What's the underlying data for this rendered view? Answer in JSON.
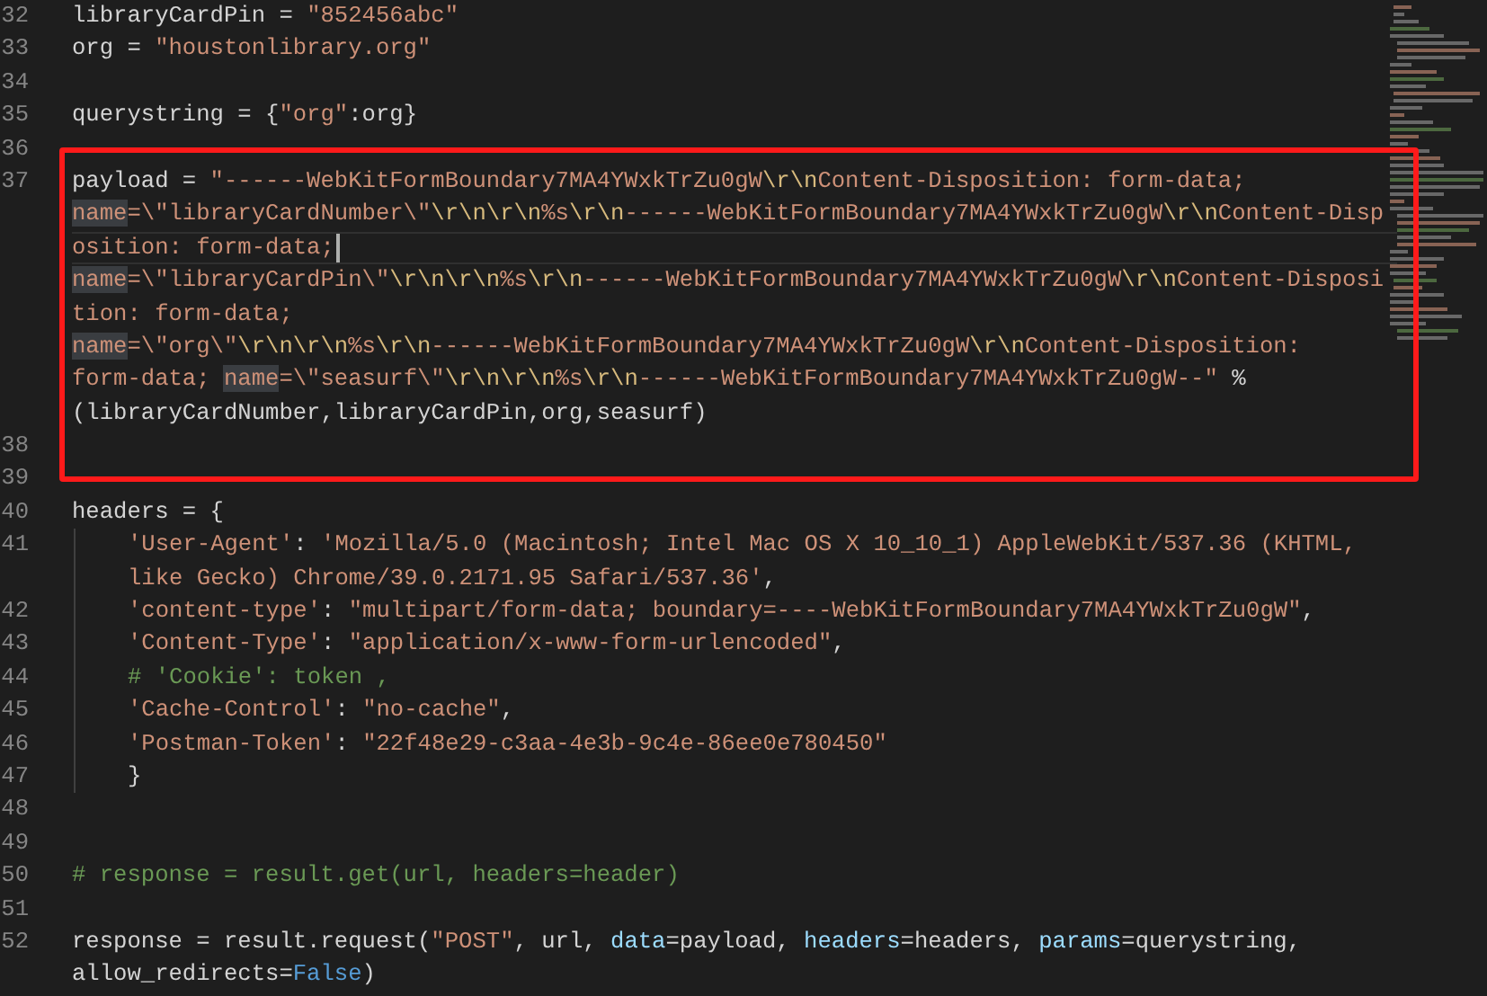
{
  "editor": {
    "lines": [
      {
        "number": "32",
        "indent_guide": false,
        "rows": [
          {
            "current": false,
            "tokens": [
              {
                "kind": "plain",
                "text": "libraryCardPin = "
              },
              {
                "kind": "string",
                "text": "\"852456abc\""
              }
            ]
          }
        ]
      },
      {
        "number": "33",
        "indent_guide": false,
        "rows": [
          {
            "current": false,
            "tokens": [
              {
                "kind": "plain",
                "text": "org = "
              },
              {
                "kind": "string",
                "text": "\"houstonlibrary.org\""
              }
            ]
          }
        ]
      },
      {
        "number": "34",
        "indent_guide": false
      },
      {
        "number": "35",
        "indent_guide": false,
        "rows": [
          {
            "current": false,
            "tokens": [
              {
                "kind": "plain",
                "text": "querystring = {"
              },
              {
                "kind": "string",
                "text": "\"org\""
              },
              {
                "kind": "plain",
                "text": ":org}"
              }
            ]
          }
        ]
      },
      {
        "number": "36",
        "indent_guide": false
      },
      {
        "number": "37",
        "indent_guide": false,
        "rows": [
          {
            "current": false,
            "tokens": [
              {
                "kind": "plain",
                "text": "payload = "
              },
              {
                "kind": "string",
                "text": "\"------WebKitFormBoundary7MA4YWxkTrZu0gW"
              },
              {
                "kind": "escape",
                "text": "\\r\\n"
              },
              {
                "kind": "string",
                "text": "Content-Disposition: form-data;"
              }
            ]
          },
          {
            "current": false,
            "tokens": [
              {
                "kind": "match",
                "text": "name"
              },
              {
                "kind": "string",
                "text": "=\\\"libraryCardNumber\\\""
              },
              {
                "kind": "escape",
                "text": "\\r\\n\\r\\n"
              },
              {
                "kind": "string",
                "text": "%s"
              },
              {
                "kind": "escape",
                "text": "\\r\\n"
              },
              {
                "kind": "string",
                "text": "------WebKitFormBoundary7MA4YWxkTrZu0gW"
              },
              {
                "kind": "escape",
                "text": "\\r\\n"
              },
              {
                "kind": "string",
                "text": "Content-Disp"
              }
            ]
          },
          {
            "current": true,
            "tokens": [
              {
                "kind": "string",
                "text": "osition: form-data;"
              }
            ]
          },
          {
            "current": false,
            "tokens": [
              {
                "kind": "match",
                "text": "name"
              },
              {
                "kind": "string",
                "text": "=\\\"libraryCardPin\\\""
              },
              {
                "kind": "escape",
                "text": "\\r\\n\\r\\n"
              },
              {
                "kind": "string",
                "text": "%s"
              },
              {
                "kind": "escape",
                "text": "\\r\\n"
              },
              {
                "kind": "string",
                "text": "------WebKitFormBoundary7MA4YWxkTrZu0gW"
              },
              {
                "kind": "escape",
                "text": "\\r\\n"
              },
              {
                "kind": "string",
                "text": "Content-Disposi"
              }
            ]
          },
          {
            "current": false,
            "tokens": [
              {
                "kind": "string",
                "text": "tion: form-data;"
              }
            ]
          },
          {
            "current": false,
            "tokens": [
              {
                "kind": "match",
                "text": "name"
              },
              {
                "kind": "string",
                "text": "=\\\"org\\\""
              },
              {
                "kind": "escape",
                "text": "\\r\\n\\r\\n"
              },
              {
                "kind": "string",
                "text": "%s"
              },
              {
                "kind": "escape",
                "text": "\\r\\n"
              },
              {
                "kind": "string",
                "text": "------WebKitFormBoundary7MA4YWxkTrZu0gW"
              },
              {
                "kind": "escape",
                "text": "\\r\\n"
              },
              {
                "kind": "string",
                "text": "Content-Disposition:"
              }
            ]
          },
          {
            "current": false,
            "tokens": [
              {
                "kind": "string",
                "text": "form-data; "
              },
              {
                "kind": "match",
                "text": "name"
              },
              {
                "kind": "string",
                "text": "=\\\"seasurf\\\""
              },
              {
                "kind": "escape",
                "text": "\\r\\n\\r\\n"
              },
              {
                "kind": "string",
                "text": "%s"
              },
              {
                "kind": "escape",
                "text": "\\r\\n"
              },
              {
                "kind": "string",
                "text": "------WebKitFormBoundary7MA4YWxkTrZu0gW--\""
              },
              {
                "kind": "plain",
                "text": " %"
              }
            ]
          },
          {
            "current": false,
            "tokens": [
              {
                "kind": "plain",
                "text": "(libraryCardNumber,libraryCardPin,org,seasurf)"
              }
            ]
          }
        ]
      },
      {
        "number": "38",
        "indent_guide": false
      },
      {
        "number": "39",
        "indent_guide": false
      },
      {
        "number": "40",
        "indent_guide": false,
        "rows": [
          {
            "current": false,
            "tokens": [
              {
                "kind": "plain",
                "text": "headers = {"
              }
            ]
          }
        ]
      },
      {
        "number": "41",
        "indent_guide": true,
        "rows": [
          {
            "current": false,
            "tokens": [
              {
                "kind": "string",
                "text": "'User-Agent'"
              },
              {
                "kind": "plain",
                "text": ": "
              },
              {
                "kind": "string",
                "text": "'Mozilla/5.0 (Macintosh; Intel Mac OS X 10_10_1) AppleWebKit/537.36 (KHTML,"
              }
            ]
          },
          {
            "current": false,
            "tokens": [
              {
                "kind": "string",
                "text": "like Gecko) Chrome/39.0.2171.95 Safari/537.36'"
              },
              {
                "kind": "plain",
                "text": ","
              }
            ]
          }
        ]
      },
      {
        "number": "42",
        "indent_guide": true,
        "rows": [
          {
            "current": false,
            "tokens": [
              {
                "kind": "string",
                "text": "'content-type'"
              },
              {
                "kind": "plain",
                "text": ": "
              },
              {
                "kind": "string",
                "text": "\"multipart/form-data; boundary=----WebKitFormBoundary7MA4YWxkTrZu0gW\""
              },
              {
                "kind": "plain",
                "text": ","
              }
            ]
          }
        ]
      },
      {
        "number": "43",
        "indent_guide": true,
        "rows": [
          {
            "current": false,
            "tokens": [
              {
                "kind": "string",
                "text": "'Content-Type'"
              },
              {
                "kind": "plain",
                "text": ": "
              },
              {
                "kind": "string",
                "text": "\"application/x-www-form-urlencoded\""
              },
              {
                "kind": "plain",
                "text": ","
              }
            ]
          }
        ]
      },
      {
        "number": "44",
        "indent_guide": true,
        "rows": [
          {
            "current": false,
            "tokens": [
              {
                "kind": "comment",
                "text": "# 'Cookie': token ,"
              }
            ]
          }
        ]
      },
      {
        "number": "45",
        "indent_guide": true,
        "rows": [
          {
            "current": false,
            "tokens": [
              {
                "kind": "string",
                "text": "'Cache-Control'"
              },
              {
                "kind": "plain",
                "text": ": "
              },
              {
                "kind": "string",
                "text": "\"no-cache\""
              },
              {
                "kind": "plain",
                "text": ","
              }
            ]
          }
        ]
      },
      {
        "number": "46",
        "indent_guide": true,
        "rows": [
          {
            "current": false,
            "tokens": [
              {
                "kind": "string",
                "text": "'Postman-Token'"
              },
              {
                "kind": "plain",
                "text": ": "
              },
              {
                "kind": "string",
                "text": "\"22f48e29-c3aa-4e3b-9c4e-86ee0e780450\""
              }
            ]
          }
        ]
      },
      {
        "number": "47",
        "indent_guide": true,
        "rows": [
          {
            "current": false,
            "tokens": [
              {
                "kind": "plain",
                "text": "}"
              }
            ]
          }
        ]
      },
      {
        "number": "48",
        "indent_guide": false
      },
      {
        "number": "49",
        "indent_guide": false
      },
      {
        "number": "50",
        "indent_guide": false,
        "rows": [
          {
            "current": false,
            "tokens": [
              {
                "kind": "comment",
                "text": "# response = result.get(url, headers=header)"
              }
            ]
          }
        ]
      },
      {
        "number": "51",
        "indent_guide": false
      },
      {
        "number": "52",
        "indent_guide": false,
        "rows": [
          {
            "current": false,
            "tokens": [
              {
                "kind": "plain",
                "text": "response = result.request("
              },
              {
                "kind": "string",
                "text": "\"POST\""
              },
              {
                "kind": "plain",
                "text": ", url, "
              },
              {
                "kind": "param",
                "text": "data"
              },
              {
                "kind": "plain",
                "text": "=payload, "
              },
              {
                "kind": "param",
                "text": "headers"
              },
              {
                "kind": "plain",
                "text": "=headers, "
              },
              {
                "kind": "param",
                "text": "params"
              },
              {
                "kind": "plain",
                "text": "=querystring,"
              }
            ]
          },
          {
            "current": false,
            "tokens": [
              {
                "kind": "plain",
                "text": "allow_redirects="
              },
              {
                "kind": "constant",
                "text": "False"
              },
              {
                "kind": "plain",
                "text": ")"
              }
            ]
          }
        ]
      }
    ]
  }
}
